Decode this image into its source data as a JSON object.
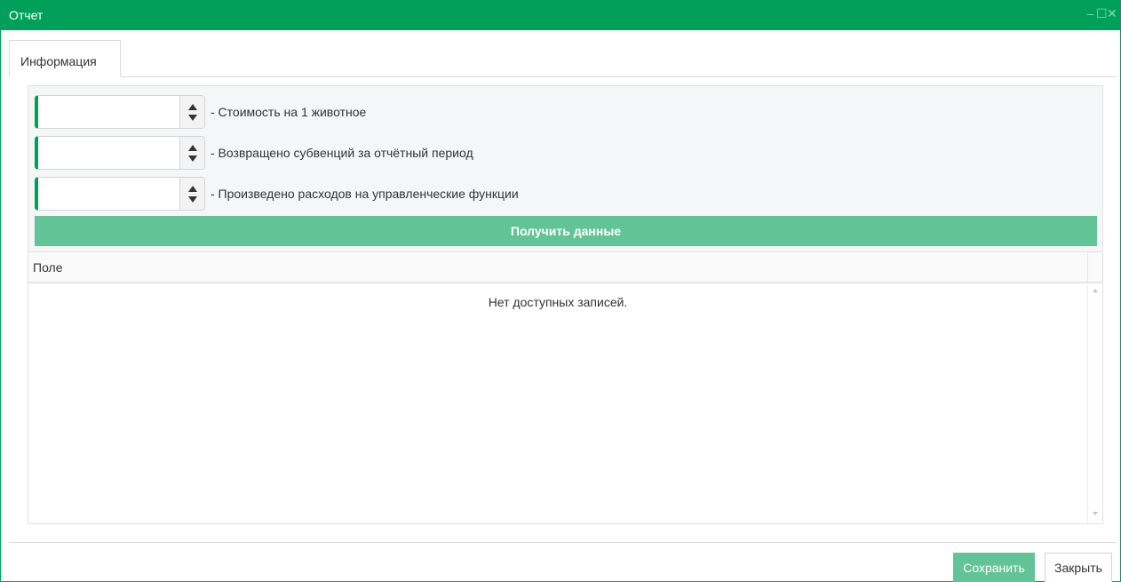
{
  "window": {
    "title": "Отчет",
    "controls": {
      "minimize": "–",
      "maximize": "☐",
      "close": "✕"
    }
  },
  "tabs": [
    {
      "label": "Информация",
      "active": true
    }
  ],
  "fields": [
    {
      "value": "",
      "label": "- Стоимость на 1 животное"
    },
    {
      "value": "",
      "label": "- Возвращено субвенций за отчётный период"
    },
    {
      "value": "",
      "label": "- Произведено расходов на управленческие функции"
    }
  ],
  "get_data_button": "Получить данные",
  "grid": {
    "columns": [
      "Поле"
    ],
    "empty_text": "Нет доступных записей."
  },
  "footer": {
    "save_label": "Сохранить",
    "close_label": "Закрыть"
  },
  "colors": {
    "titlebar": "#00a05a",
    "accent_button": "#62c396",
    "input_accent": "#00a05a"
  },
  "icons": {
    "minimize": "minimize-icon",
    "maximize": "maximize-icon",
    "close": "close-icon",
    "spin_up": "arrow-up-icon",
    "spin_down": "arrow-down-icon"
  }
}
